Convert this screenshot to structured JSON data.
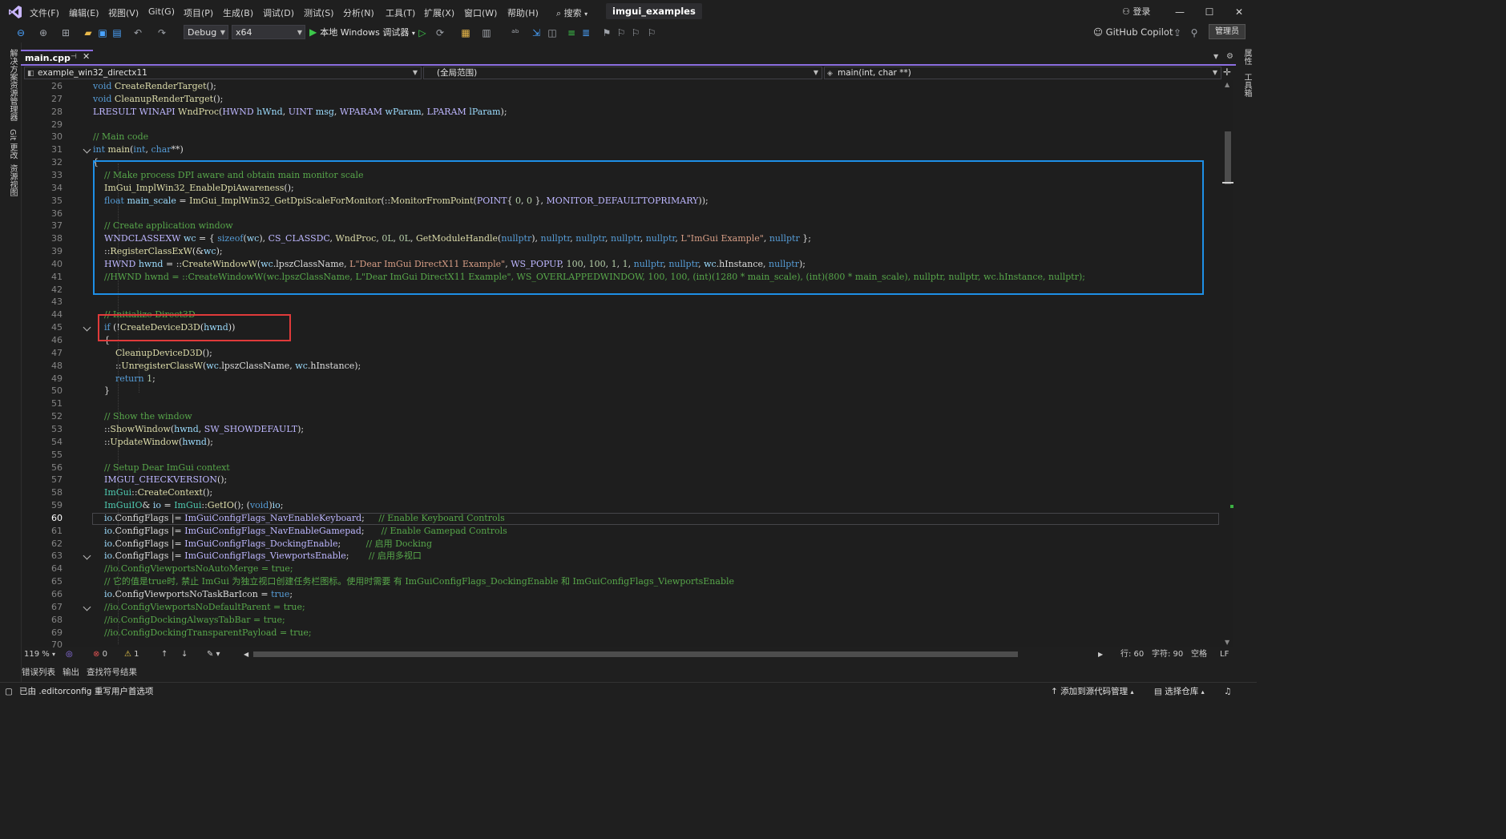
{
  "menu": {
    "items": [
      "文件(F)",
      "编辑(E)",
      "视图(V)",
      "Git(G)",
      "项目(P)",
      "生成(B)",
      "调试(D)",
      "测试(S)",
      "分析(N)",
      "工具(T)",
      "扩展(X)",
      "窗口(W)",
      "帮助(H)"
    ],
    "search": "搜索",
    "solution_title": "imgui_examples",
    "login": "登录"
  },
  "toolbar": {
    "configuration": "Debug",
    "platform": "x64",
    "run_label": "本地 Windows 调试器",
    "copilot": "GitHub Copilot",
    "admin": "管理员"
  },
  "left_strip": {
    "labels": [
      "解决方案资源管理器",
      "Git 更改",
      "资源视图"
    ]
  },
  "right_strip": {
    "labels": [
      "属性",
      "工具箱"
    ]
  },
  "tab": {
    "filename": "main.cpp"
  },
  "nav": {
    "project": "example_win32_directx11",
    "scope": "(全局范围)",
    "member": "main(int, char **)"
  },
  "editor": {
    "current_line": 60,
    "lines": [
      {
        "n": 26,
        "fold": false,
        "html": "<span class=\"kw\">void</span> <span class=\"fn\">CreateRenderTarget</span>();"
      },
      {
        "n": 27,
        "fold": false,
        "html": "<span class=\"kw\">void</span> <span class=\"fn\">CleanupRenderTarget</span>();"
      },
      {
        "n": 28,
        "fold": false,
        "html": "<span class=\"mac\">LRESULT</span> <span class=\"mac\">WINAPI</span> <span class=\"fn\">WndProc</span>(<span class=\"mac\">HWND</span> <span class=\"var\">hWnd</span>, <span class=\"mac\">UINT</span> <span class=\"var\">msg</span>, <span class=\"mac\">WPARAM</span> <span class=\"var\">wParam</span>, <span class=\"mac\">LPARAM</span> <span class=\"var\">lParam</span>);"
      },
      {
        "n": 29,
        "fold": false,
        "html": ""
      },
      {
        "n": 30,
        "fold": false,
        "html": "<span class=\"cm\">// Main code</span>"
      },
      {
        "n": 31,
        "fold": true,
        "html": "<span class=\"kw\">int</span> <span class=\"fn\">main</span>(<span class=\"kw\">int</span>, <span class=\"kw\">char</span>**)"
      },
      {
        "n": 32,
        "fold": false,
        "html": "{"
      },
      {
        "n": 33,
        "fold": false,
        "html": "    <span class=\"cm\">// Make process DPI aware and obtain main monitor scale</span>"
      },
      {
        "n": 34,
        "fold": false,
        "html": "    <span class=\"fn\">ImGui_ImplWin32_EnableDpiAwareness</span>();"
      },
      {
        "n": 35,
        "fold": false,
        "html": "    <span class=\"kw\">float</span> <span class=\"var\">main_scale</span> = <span class=\"fn\">ImGui_ImplWin32_GetDpiScaleForMonitor</span>(::<span class=\"fn\">MonitorFromPoint</span>(<span class=\"mac\">POINT</span>{ <span class=\"num\">0</span>, <span class=\"num\">0</span> }, <span class=\"mac\">MONITOR_DEFAULTTOPRIMARY</span>));"
      },
      {
        "n": 36,
        "fold": false,
        "html": ""
      },
      {
        "n": 37,
        "fold": false,
        "html": "    <span class=\"cm\">// Create application window</span>"
      },
      {
        "n": 38,
        "fold": false,
        "html": "    <span class=\"mac\">WNDCLASSEXW</span> <span class=\"var\">wc</span> = { <span class=\"kw\">sizeof</span>(<span class=\"var\">wc</span>), <span class=\"mac\">CS_CLASSDC</span>, <span class=\"fn\">WndProc</span>, <span class=\"num\">0L</span>, <span class=\"num\">0L</span>, <span class=\"fn\">GetModuleHandle</span>(<span class=\"kw\">nullptr</span>), <span class=\"kw\">nullptr</span>, <span class=\"kw\">nullptr</span>, <span class=\"kw\">nullptr</span>, <span class=\"kw\">nullptr</span>, <span class=\"str\">L\"ImGui Example\"</span>, <span class=\"kw\">nullptr</span> };"
      },
      {
        "n": 39,
        "fold": false,
        "html": "    ::<span class=\"fn\">RegisterClassExW</span>(&amp;<span class=\"var\">wc</span>);"
      },
      {
        "n": 40,
        "fold": false,
        "html": "    <span class=\"mac\">HWND</span> <span class=\"var\">hwnd</span> = ::<span class=\"fn\">CreateWindowW</span>(<span class=\"var\">wc</span>.lpszClassName, <span class=\"str\">L\"Dear ImGui DirectX11 Example\"</span>, <span class=\"mac\">WS_POPUP</span>, <span class=\"num\">100</span>, <span class=\"num\">100</span>, <span class=\"num\">1</span>, <span class=\"num\">1</span>, <span class=\"kw\">nullptr</span>, <span class=\"kw\">nullptr</span>, <span class=\"var\">wc</span>.hInstance, <span class=\"kw\">nullptr</span>);"
      },
      {
        "n": 41,
        "fold": false,
        "html": "    <span class=\"cm\">//HWND hwnd = ::CreateWindowW(wc.lpszClassName, L\"Dear ImGui DirectX11 Example\", WS_OVERLAPPEDWINDOW, 100, 100, (int)(1280 * main_scale), (int)(800 * main_scale), nullptr, nullptr, wc.hInstance, nullptr);</span>"
      },
      {
        "n": 42,
        "fold": false,
        "html": ""
      },
      {
        "n": 43,
        "fold": false,
        "html": ""
      },
      {
        "n": 44,
        "fold": false,
        "html": "    <span class=\"cm\">// Initialize Direct3D</span>"
      },
      {
        "n": 45,
        "fold": true,
        "html": "    <span class=\"kw\">if</span> (!<span class=\"fn\">CreateDeviceD3D</span>(<span class=\"var\">hwnd</span>))"
      },
      {
        "n": 46,
        "fold": false,
        "html": "    {"
      },
      {
        "n": 47,
        "fold": false,
        "html": "        <span class=\"fn\">CleanupDeviceD3D</span>();"
      },
      {
        "n": 48,
        "fold": false,
        "html": "        ::<span class=\"fn\">UnregisterClassW</span>(<span class=\"var\">wc</span>.lpszClassName, <span class=\"var\">wc</span>.hInstance);"
      },
      {
        "n": 49,
        "fold": false,
        "html": "        <span class=\"kw\">return</span> <span class=\"num\">1</span>;"
      },
      {
        "n": 50,
        "fold": false,
        "html": "    }"
      },
      {
        "n": 51,
        "fold": false,
        "html": ""
      },
      {
        "n": 52,
        "fold": false,
        "html": "    <span class=\"cm\">// Show the window</span>"
      },
      {
        "n": 53,
        "fold": false,
        "html": "    ::<span class=\"fn\">ShowWindow</span>(<span class=\"var\">hwnd</span>, <span class=\"mac\">SW_SHOWDEFAULT</span>);"
      },
      {
        "n": 54,
        "fold": false,
        "html": "    ::<span class=\"fn\">UpdateWindow</span>(<span class=\"var\">hwnd</span>);"
      },
      {
        "n": 55,
        "fold": false,
        "html": ""
      },
      {
        "n": 56,
        "fold": false,
        "html": "    <span class=\"cm\">// Setup Dear ImGui context</span>"
      },
      {
        "n": 57,
        "fold": false,
        "html": "    <span class=\"mac\">IMGUI_CHECKVERSION</span>();"
      },
      {
        "n": 58,
        "fold": false,
        "html": "    <span class=\"ty\">ImGui</span>::<span class=\"fn\">CreateContext</span>();"
      },
      {
        "n": 59,
        "fold": false,
        "html": "    <span class=\"ty\">ImGuiIO</span>&amp; <span class=\"var\">io</span> = <span class=\"ty\">ImGui</span>::<span class=\"fn\">GetIO</span>(); (<span class=\"kw\">void</span>)<span class=\"var\">io</span>;"
      },
      {
        "n": 60,
        "fold": false,
        "html": "    <span class=\"var\">io</span>.ConfigFlags |= <span class=\"mac\">ImGuiConfigFlags_NavEnableKeyboard</span>;     <span class=\"cm\">// Enable Keyboard Controls</span>"
      },
      {
        "n": 61,
        "fold": false,
        "html": "    <span class=\"var\">io</span>.ConfigFlags |= <span class=\"mac\">ImGuiConfigFlags_NavEnableGamepad</span>;      <span class=\"cm\">// Enable Gamepad Controls</span>"
      },
      {
        "n": 62,
        "fold": false,
        "html": "    <span class=\"var\">io</span>.ConfigFlags |= <span class=\"mac\">ImGuiConfigFlags_DockingEnable</span>;         <span class=\"cm\">// 启用 Docking</span>"
      },
      {
        "n": 63,
        "fold": true,
        "html": "    <span class=\"var\">io</span>.ConfigFlags |= <span class=\"mac\">ImGuiConfigFlags_ViewportsEnable</span>;       <span class=\"cm\">// 启用多视口</span>"
      },
      {
        "n": 64,
        "fold": false,
        "html": "    <span class=\"cm\">//io.ConfigViewportsNoAutoMerge = true;</span>"
      },
      {
        "n": 65,
        "fold": false,
        "html": "    <span class=\"cm\">// 它的值是true时, 禁止 ImGui 为独立视口创建任务栏图标。使用时需要 有 ImGuiConfigFlags_DockingEnable 和 ImGuiConfigFlags_ViewportsEnable</span>"
      },
      {
        "n": 66,
        "fold": false,
        "html": "    <span class=\"var\">io</span>.ConfigViewportsNoTaskBarIcon = <span class=\"kw\">true</span>;"
      },
      {
        "n": 67,
        "fold": true,
        "html": "    <span class=\"cm\">//io.ConfigViewportsNoDefaultParent = true;</span>"
      },
      {
        "n": 68,
        "fold": false,
        "html": "    <span class=\"cm\">//io.ConfigDockingAlwaysTabBar = true;</span>"
      },
      {
        "n": 69,
        "fold": false,
        "html": "    <span class=\"cm\">//io.ConfigDockingTransparentPayload = true;</span>"
      },
      {
        "n": 70,
        "fold": false,
        "html": ""
      }
    ]
  },
  "editor_status": {
    "zoom": "119 %",
    "errors": "0",
    "warnings": "1",
    "line": "行: 60",
    "char": "字符: 90",
    "whitespace": "空格",
    "eol": "LF"
  },
  "output_tabs": [
    "错误列表",
    "输出",
    "查找符号结果"
  ],
  "statusbar": {
    "message": "已由 .editorconfig 重写用户首选项",
    "source_control": "添加到源代码管理",
    "repo": "选择仓库"
  },
  "colors": {
    "accent": "#8c6ee0",
    "highlight_blue": "#1e8fe6",
    "highlight_red": "#e03a3a",
    "run_green": "#3cc84a"
  }
}
